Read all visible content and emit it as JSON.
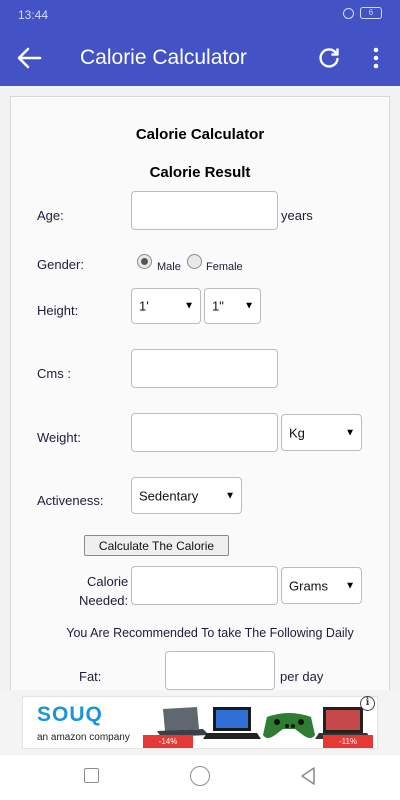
{
  "status_bar": {
    "time": "13:44",
    "battery": "6"
  },
  "app_bar": {
    "title": "Calorie Calculator"
  },
  "form": {
    "heading": "Calorie Calculator",
    "subheading": "Calorie Result",
    "age": {
      "label": "Age:",
      "value": "",
      "unit": "years"
    },
    "gender": {
      "label": "Gender:",
      "options": [
        "Male",
        "Female"
      ],
      "selected": "Male"
    },
    "height": {
      "label": "Height:",
      "feet": "1'",
      "inches": "1\""
    },
    "cms": {
      "label": "Cms :",
      "value": ""
    },
    "weight": {
      "label": "Weight:",
      "value": "",
      "unit": "Kg"
    },
    "activeness": {
      "label": "Activeness:",
      "value": "Sedentary"
    },
    "calculate_button": "Calculate The Calorie",
    "calorie_needed": {
      "label_line1": "Calorie",
      "label_line2": "Needed:",
      "value": "",
      "unit": "Grams"
    },
    "recommendation": "You Are Recommended To take The Following Daily",
    "fat": {
      "label": "Fat:",
      "value": "",
      "suffix": "per day"
    }
  },
  "ad": {
    "brand": "SOUQ",
    "tagline": "an amazon company",
    "discount_1": "-14%",
    "discount_2": "-11%",
    "info": "i"
  },
  "colors": {
    "primary": "#4352c4",
    "ad_brand": "#1a94dc",
    "badge": "#e53935"
  }
}
